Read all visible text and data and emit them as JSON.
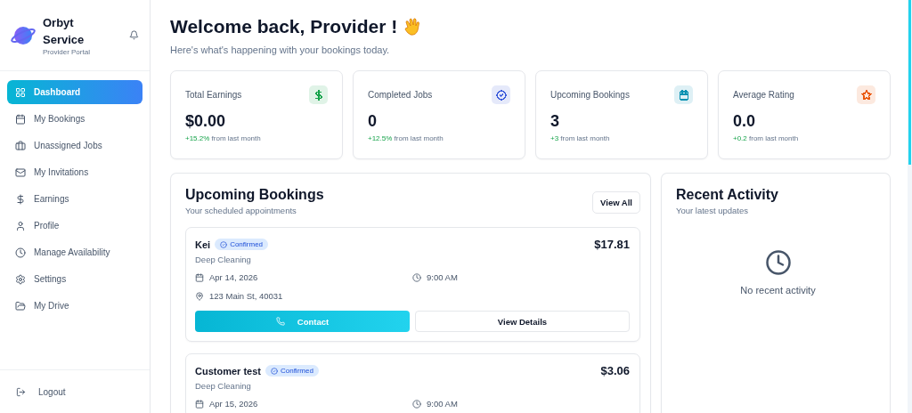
{
  "brand": {
    "name": "Orbyt Service",
    "subtitle": "Provider Portal"
  },
  "sidebar": {
    "items": [
      {
        "label": "Dashboard",
        "selected": true
      },
      {
        "label": "My Bookings",
        "selected": false
      },
      {
        "label": "Unassigned Jobs",
        "selected": false
      },
      {
        "label": "My Invitations",
        "selected": false
      },
      {
        "label": "Earnings",
        "selected": false
      },
      {
        "label": "Profile",
        "selected": false
      },
      {
        "label": "Manage Availability",
        "selected": false
      },
      {
        "label": "Settings",
        "selected": false
      },
      {
        "label": "My Drive",
        "selected": false
      }
    ],
    "logout": "Logout"
  },
  "header": {
    "title": "Welcome back, Provider !",
    "subtitle": "Here's what's happening with your bookings today."
  },
  "stats": [
    {
      "label": "Total Earnings",
      "value": "$0.00",
      "change": "+15.2%",
      "note": "from last month",
      "color": "#16a34a"
    },
    {
      "label": "Completed Jobs",
      "value": "0",
      "change": "+12.5%",
      "note": "from last month",
      "color": "#3b5bdb"
    },
    {
      "label": "Upcoming Bookings",
      "value": "3",
      "change": "+3",
      "note": "from last month",
      "color": "#0891b2"
    },
    {
      "label": "Average Rating",
      "value": "0.0",
      "change": "+0.2",
      "note": "from last month",
      "color": "#ea580c"
    }
  ],
  "bookings": {
    "title": "Upcoming Bookings",
    "subtitle": "Your scheduled appointments",
    "view_all": "View All",
    "items": [
      {
        "customer": "Kei",
        "status": "Confirmed",
        "service": "Deep Cleaning",
        "price": "$17.81",
        "date": "Apr 14, 2026",
        "time": "9:00 AM",
        "address": "123 Main St, 40031",
        "contact": "Contact",
        "details": "View Details"
      },
      {
        "customer": "Customer test",
        "status": "Confirmed",
        "service": "Deep Cleaning",
        "price": "$3.06",
        "date": "Apr 15, 2026",
        "time": "9:00 AM"
      }
    ]
  },
  "activity": {
    "title": "Recent Activity",
    "subtitle": "Your latest updates",
    "empty": "No recent activity"
  }
}
